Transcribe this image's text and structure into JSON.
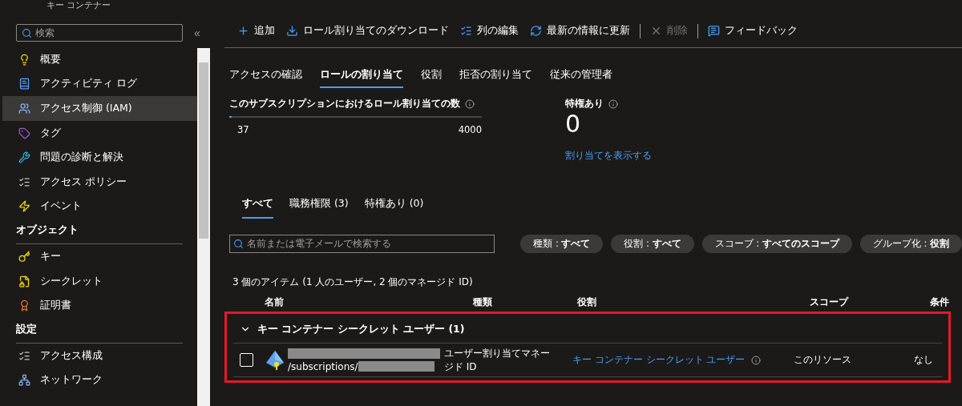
{
  "header": {
    "title": "キー コンテナー"
  },
  "sidebar": {
    "search": {
      "placeholder": "検索"
    },
    "collapse": "«",
    "sections": [
      {
        "items": [
          {
            "label": "概要",
            "selected": false
          },
          {
            "label": "アクティビティ ログ",
            "selected": false
          },
          {
            "label": "アクセス制御 (IAM)",
            "selected": true
          },
          {
            "label": "タグ",
            "selected": false
          },
          {
            "label": "問題の診断と解決",
            "selected": false
          },
          {
            "label": "アクセス ポリシー",
            "selected": false
          },
          {
            "label": "イベント",
            "selected": false
          }
        ]
      },
      {
        "heading": "オブジェクト",
        "items": [
          {
            "label": "キー",
            "selected": false
          },
          {
            "label": "シークレット",
            "selected": false
          },
          {
            "label": "証明書",
            "selected": false
          }
        ]
      },
      {
        "heading": "設定",
        "items": [
          {
            "label": "アクセス構成",
            "selected": false
          },
          {
            "label": "ネットワーク",
            "selected": false
          }
        ]
      }
    ]
  },
  "toolbar": [
    {
      "label": "追加",
      "disabled": false,
      "separator": false
    },
    {
      "label": "ロール割り当てのダウンロード",
      "disabled": false,
      "separator": false
    },
    {
      "label": "列の編集",
      "disabled": false,
      "separator": false
    },
    {
      "label": "最新の情報に更新",
      "disabled": false,
      "separator": true
    },
    {
      "label": "削除",
      "disabled": true,
      "separator": true
    },
    {
      "label": "フィードバック",
      "disabled": false,
      "separator": false
    }
  ],
  "tabs": [
    {
      "label": "アクセスの確認",
      "selected": false
    },
    {
      "label": "ロールの割り当て",
      "selected": true
    },
    {
      "label": "役割",
      "selected": false
    },
    {
      "label": "拒否の割り当て",
      "selected": false
    },
    {
      "label": "従来の管理者",
      "selected": false
    }
  ],
  "assignment_count": {
    "title": "このサブスクリプションにおけるロール割り当ての数",
    "level": 0.009,
    "current": "37",
    "max": "4000"
  },
  "privileged": {
    "title": "特権あり",
    "value": "0",
    "link": "割り当てを表示する"
  },
  "subtabs": [
    {
      "label": "すべて",
      "selected": true
    },
    {
      "label": "職務権限 (3)",
      "selected": false
    },
    {
      "label": "特権あり (0)",
      "selected": false
    }
  ],
  "search": {
    "placeholder": "名前または電子メールで検索する"
  },
  "filters": [
    {
      "name": "種類 : ",
      "value": "すべて"
    },
    {
      "name": "役割 : ",
      "value": "すべて"
    },
    {
      "name": "スコープ : ",
      "value": "すべてのスコープ"
    },
    {
      "name": "グループ化 : ",
      "value": "役割"
    }
  ],
  "item_count": "3 個のアイテム (1 人のユーザー, 2 個のマネージド ID)",
  "table": {
    "columns": [
      "名前",
      "種類",
      "役割",
      "スコープ",
      "条件"
    ],
    "groups": [
      {
        "title": "キー コンテナー シークレット ユーザー (1)",
        "expanded": true,
        "rows": [
          {
            "checked": false,
            "name_line2": "/subscriptions/",
            "type": "ユーザー割り当てマネージド ID",
            "role": "キー コンテナー シークレット ユーザー",
            "scope": "このリソース",
            "condition": "なし"
          }
        ]
      }
    ]
  }
}
